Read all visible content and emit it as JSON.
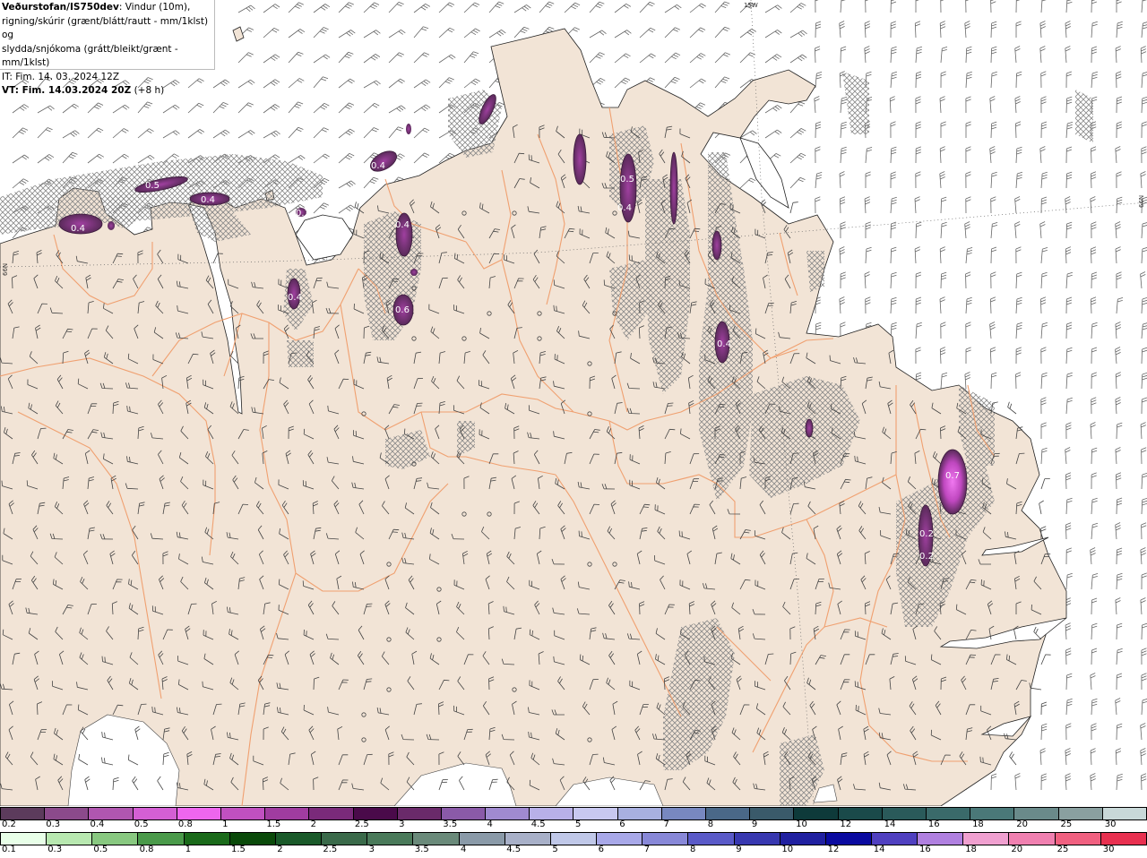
{
  "header": {
    "source": "Veðurstofan/IS750dev",
    "line1_rest": ": Vindur (10m),",
    "line2": "rigning/skúrir (grænt/blátt/rautt - mm/1klst) og",
    "line3": "slydda/snjókoma (grátt/bleikt/grænt - mm/1klst)",
    "it": "IT: Fim. 14. 03. 2024 12Z",
    "vt_bold": "VT: Fim. 14.03.2024 20Z",
    "vt_rest": " (+8 h)"
  },
  "axis_labels": {
    "top": "15W",
    "right": "66N",
    "left": "66N"
  },
  "precip_labels": [
    "0.4",
    "0.5",
    "0.4",
    "0.3",
    "0.4",
    "0.4",
    "0.6",
    "0.4",
    "0.5",
    "0.4",
    "0.4",
    "0.7",
    "0.2",
    "0.2"
  ],
  "legend_snow": {
    "labels": [
      "0.2",
      "0.3",
      "0.4",
      "0.5",
      "0.8",
      "1",
      "1.5",
      "2",
      "2.5",
      "3",
      "3.5",
      "4",
      "4.5",
      "5",
      "6",
      "7",
      "8",
      "9",
      "10",
      "12",
      "14",
      "16",
      "18",
      "20",
      "25",
      "30"
    ],
    "colors": [
      "#5c3b5c",
      "#8b4a8b",
      "#b056b0",
      "#d45fd4",
      "#ee66ee",
      "#c050c0",
      "#a03ca0",
      "#7a2a7a",
      "#4a0a4a",
      "#6a2a6a",
      "#8a5aa8",
      "#a08ad0",
      "#b8b0e8",
      "#c8c8f0",
      "#a8b0e0",
      "#7888c0",
      "#4a6888",
      "#3a5a6a",
      "#0e3a3a",
      "#1a4a4a",
      "#2a5a5a",
      "#3a6a6a",
      "#4a7878",
      "#6a8a8a",
      "#8aa0a0",
      "#c8d8d8"
    ]
  },
  "legend_rain": {
    "labels": [
      "0.1",
      "0.3",
      "0.5",
      "0.8",
      "1",
      "1.5",
      "2",
      "2.5",
      "3",
      "3.5",
      "4",
      "4.5",
      "5",
      "6",
      "7",
      "8",
      "9",
      "10",
      "12",
      "14",
      "16",
      "18",
      "20",
      "25",
      "30"
    ],
    "colors": [
      "#e8ffe8",
      "#b8e8b0",
      "#88c880",
      "#4a9a4a",
      "#1a6a1a",
      "#0a4a0a",
      "#1a5a2a",
      "#3a6a4a",
      "#4a7a5a",
      "#6a8a7a",
      "#8a9aa8",
      "#a8b0c8",
      "#c0c8e8",
      "#a8a8e8",
      "#8888d8",
      "#5a5ac8",
      "#3838b0",
      "#2020a0",
      "#0a0aa0",
      "#5040c0",
      "#b080e0",
      "#f0a0d0",
      "#f080b0",
      "#f06080",
      "#e83050",
      "#e01020"
    ]
  },
  "colors": {
    "land": "#f2e4d6",
    "border": "#f0a070",
    "hatch": "#888888",
    "precip_dark": "#5a2a5a",
    "precip_mid": "#8a3a8a",
    "precip_bright": "#e060e0"
  }
}
